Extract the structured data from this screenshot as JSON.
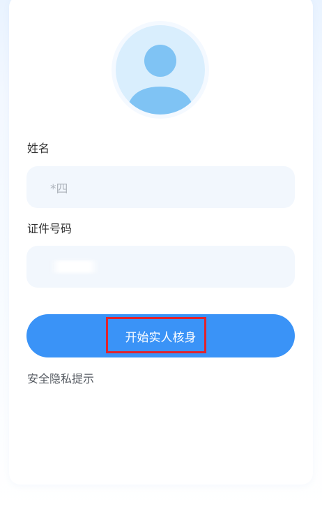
{
  "form": {
    "name_label": "姓名",
    "name_value": "*四",
    "id_label": "证件号码",
    "id_value": "",
    "submit_label": "开始实人核身",
    "privacy_link": "安全隐私提示"
  },
  "colors": {
    "primary": "#3a93f7",
    "field_bg": "#f2f7fd",
    "avatar": "#84c7f5",
    "highlight": "#e0242d"
  },
  "icons": {
    "avatar": "user-avatar-icon"
  }
}
